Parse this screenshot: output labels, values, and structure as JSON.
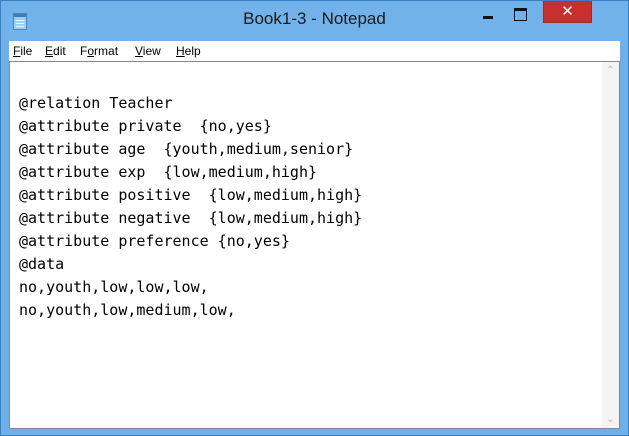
{
  "window": {
    "title": "Book1-3 - Notepad"
  },
  "titlebar_controls": {
    "minimize": "–",
    "maximize": "□",
    "close": "✕"
  },
  "menu": {
    "items": [
      {
        "label": "File",
        "access": "F",
        "rest": "ile"
      },
      {
        "label": "Edit",
        "access": "E",
        "rest": "dit"
      },
      {
        "label": "Format",
        "access": "o",
        "pre": "F",
        "rest": "rmat"
      },
      {
        "label": "View",
        "access": "V",
        "rest": "iew"
      },
      {
        "label": "Help",
        "access": "H",
        "rest": "elp"
      }
    ]
  },
  "editor": {
    "lines": [
      "@relation Teacher",
      "@attribute private  {no,yes}",
      "@attribute age  {youth,medium,senior}",
      "@attribute exp  {low,medium,high}",
      "@attribute positive  {low,medium,high}",
      "@attribute negative  {low,medium,high}",
      "@attribute preference {no,yes}",
      "@data",
      "no,youth,low,low,low,",
      "no,youth,low,medium,low,"
    ]
  },
  "scrollbar": {
    "up_icon": "scroll-up-arrow",
    "down_icon": "scroll-down-arrow"
  }
}
